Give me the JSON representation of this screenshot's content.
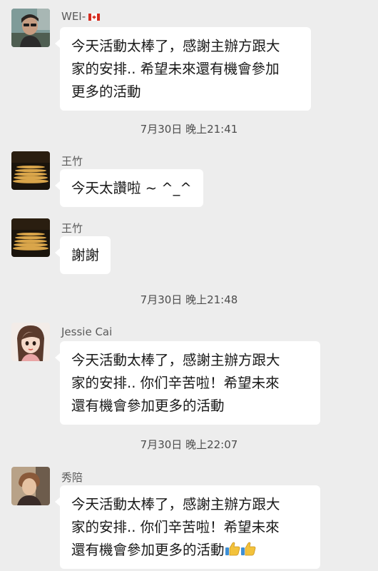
{
  "messages": [
    {
      "sender": "WEI-",
      "sender_flag_icon": "canada-flag-icon",
      "lines": [
        "今天活動太棒了，感謝主辦方跟大",
        "家的安排.. 希望未來還有機會參加",
        "更多的活動"
      ]
    },
    {
      "sender": "王竹",
      "lines": [
        "今天太讚啦 ~ ^_^"
      ]
    },
    {
      "sender": "王竹",
      "lines": [
        "謝謝"
      ]
    },
    {
      "sender": "Jessie Cai",
      "lines": [
        "今天活動太棒了，感謝主辦方跟大",
        "家的安排.. 你们辛苦啦！希望未來",
        "還有機會參加更多的活動"
      ]
    },
    {
      "sender": "秀陪",
      "lines": [
        "今天活動太棒了，感謝主辦方跟大",
        "家的安排.. 你们辛苦啦！希望未來",
        "還有機會參加更多的活動"
      ],
      "trailing_icons": [
        "thumbs-up-icon",
        "thumbs-up-icon"
      ]
    }
  ],
  "timestamps": [
    "7月30日 晚上21:41",
    "7月30日 晚上21:48",
    "7月30日 晚上22:07"
  ],
  "colors": {
    "background": "#ededed",
    "bubble": "#ffffff",
    "text": "#181818",
    "meta_text": "#5a5a5a"
  }
}
